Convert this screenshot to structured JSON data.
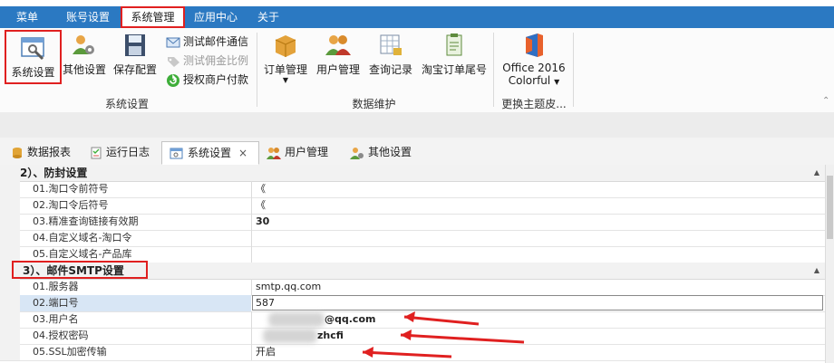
{
  "menu": {
    "items": [
      "菜单",
      "账号设置",
      "系统管理",
      "应用中心",
      "关于"
    ]
  },
  "ribbon": {
    "system_settings": "系统设置",
    "other_settings": "其他设置",
    "save_config": "保存配置",
    "test_mail": "测试邮件通信",
    "test_commission": "测试佣金比例",
    "authorize_payment": "授权商户付款",
    "order_mgmt": "订单管理",
    "user_mgmt": "用户管理",
    "query_records": "查询记录",
    "taobao_order_tail": "淘宝订单尾号",
    "theme_line1": "Office 2016",
    "theme_line2": "Colorful",
    "group_system": "系统设置",
    "group_data": "数据维护",
    "group_theme": "更换主题皮..."
  },
  "tabs": {
    "data_report": "数据报表",
    "run_log": "运行日志",
    "system_settings": "系统设置",
    "user_mgmt": "用户管理",
    "other_settings": "其他设置",
    "close_glyph": "×"
  },
  "grid": {
    "section2_title": "2）、防封设置",
    "section2_rows": [
      {
        "label": "01.淘口令前符号",
        "value": "《"
      },
      {
        "label": "02.淘口令后符号",
        "value": "《"
      },
      {
        "label": "03.精准查询链接有效期",
        "value": "30"
      },
      {
        "label": "04.自定义域名-淘口令",
        "value": ""
      },
      {
        "label": "05.自定义域名-产品库",
        "value": ""
      }
    ],
    "section3_title": "3）、邮件SMTP设置",
    "section3_rows": [
      {
        "label": "01.服务器",
        "value": "smtp.qq.com"
      },
      {
        "label": "02.端口号",
        "value": "587"
      },
      {
        "label": "03.用户名",
        "value": "@qq.com"
      },
      {
        "label": "04.授权密码",
        "value": "zhcfi"
      },
      {
        "label": "05.SSL加密传输",
        "value": "开启"
      }
    ]
  },
  "colors": {
    "menubar": "#2b79c2",
    "highlight": "#e02020"
  }
}
